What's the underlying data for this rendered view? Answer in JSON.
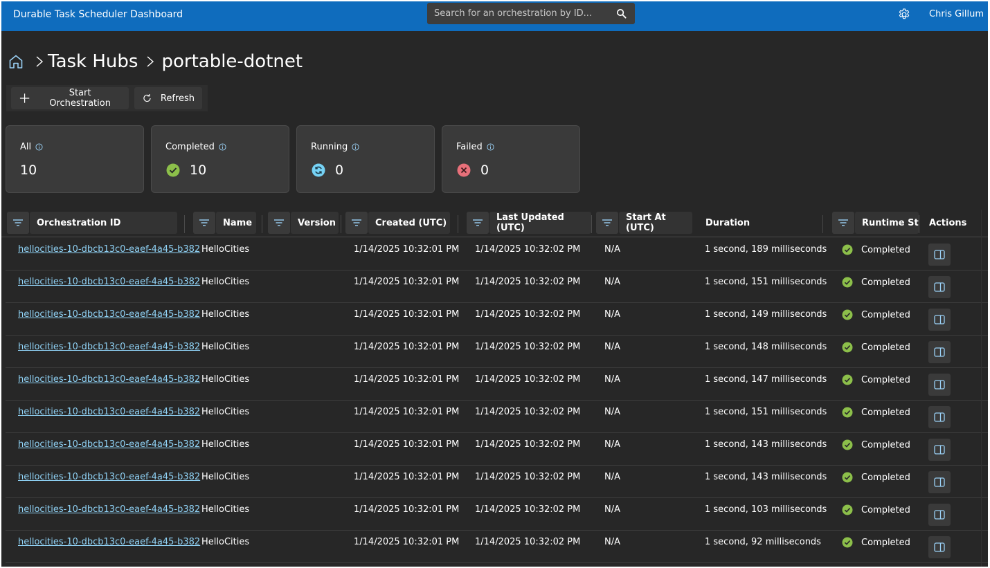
{
  "header": {
    "title": "Durable Task Scheduler Dashboard",
    "search_placeholder": "Search for an orchestration by ID...",
    "user_name": "Chris Gillum"
  },
  "breadcrumb": {
    "items": [
      "Task Hubs",
      "portable-dotnet"
    ]
  },
  "toolbar": {
    "start_label": "Start Orchestration",
    "refresh_label": "Refresh"
  },
  "stats": [
    {
      "label": "All",
      "value": "10",
      "status": "none"
    },
    {
      "label": "Completed",
      "value": "10",
      "status": "completed"
    },
    {
      "label": "Running",
      "value": "0",
      "status": "running"
    },
    {
      "label": "Failed",
      "value": "0",
      "status": "failed"
    }
  ],
  "colors": {
    "header": "#0f6cbd",
    "background": "#272727",
    "link": "#8fd1f4",
    "completed": "#8cbf4a",
    "running": "#76d2f5",
    "failed": "#e8707a"
  },
  "table": {
    "columns": [
      "Orchestration ID",
      "Name",
      "Version",
      "Created (UTC)",
      "Last Updated (UTC)",
      "Start At (UTC)",
      "Duration",
      "Runtime Stat",
      "Actions"
    ],
    "rows": [
      {
        "id": "hellocities-10-dbcb13c0-eaef-4a45-b382",
        "name": "HelloCities",
        "version": "",
        "created": "1/14/2025 10:32:01 PM",
        "updated": "1/14/2025 10:32:02 PM",
        "start_at": "N/A",
        "duration": "1 second, 189 milliseconds",
        "status": "Completed"
      },
      {
        "id": "hellocities-10-dbcb13c0-eaef-4a45-b382",
        "name": "HelloCities",
        "version": "",
        "created": "1/14/2025 10:32:01 PM",
        "updated": "1/14/2025 10:32:02 PM",
        "start_at": "N/A",
        "duration": "1 second, 151 milliseconds",
        "status": "Completed"
      },
      {
        "id": "hellocities-10-dbcb13c0-eaef-4a45-b382",
        "name": "HelloCities",
        "version": "",
        "created": "1/14/2025 10:32:01 PM",
        "updated": "1/14/2025 10:32:02 PM",
        "start_at": "N/A",
        "duration": "1 second, 149 milliseconds",
        "status": "Completed"
      },
      {
        "id": "hellocities-10-dbcb13c0-eaef-4a45-b382",
        "name": "HelloCities",
        "version": "",
        "created": "1/14/2025 10:32:01 PM",
        "updated": "1/14/2025 10:32:02 PM",
        "start_at": "N/A",
        "duration": "1 second, 148 milliseconds",
        "status": "Completed"
      },
      {
        "id": "hellocities-10-dbcb13c0-eaef-4a45-b382",
        "name": "HelloCities",
        "version": "",
        "created": "1/14/2025 10:32:01 PM",
        "updated": "1/14/2025 10:32:02 PM",
        "start_at": "N/A",
        "duration": "1 second, 147 milliseconds",
        "status": "Completed"
      },
      {
        "id": "hellocities-10-dbcb13c0-eaef-4a45-b382",
        "name": "HelloCities",
        "version": "",
        "created": "1/14/2025 10:32:01 PM",
        "updated": "1/14/2025 10:32:02 PM",
        "start_at": "N/A",
        "duration": "1 second, 151 milliseconds",
        "status": "Completed"
      },
      {
        "id": "hellocities-10-dbcb13c0-eaef-4a45-b382",
        "name": "HelloCities",
        "version": "",
        "created": "1/14/2025 10:32:01 PM",
        "updated": "1/14/2025 10:32:02 PM",
        "start_at": "N/A",
        "duration": "1 second, 143 milliseconds",
        "status": "Completed"
      },
      {
        "id": "hellocities-10-dbcb13c0-eaef-4a45-b382",
        "name": "HelloCities",
        "version": "",
        "created": "1/14/2025 10:32:01 PM",
        "updated": "1/14/2025 10:32:02 PM",
        "start_at": "N/A",
        "duration": "1 second, 143 milliseconds",
        "status": "Completed"
      },
      {
        "id": "hellocities-10-dbcb13c0-eaef-4a45-b382",
        "name": "HelloCities",
        "version": "",
        "created": "1/14/2025 10:32:01 PM",
        "updated": "1/14/2025 10:32:02 PM",
        "start_at": "N/A",
        "duration": "1 second, 103 milliseconds",
        "status": "Completed"
      },
      {
        "id": "hellocities-10-dbcb13c0-eaef-4a45-b382",
        "name": "HelloCities",
        "version": "",
        "created": "1/14/2025 10:32:01 PM",
        "updated": "1/14/2025 10:32:02 PM",
        "start_at": "N/A",
        "duration": "1 second, 92 milliseconds",
        "status": "Completed"
      }
    ]
  }
}
